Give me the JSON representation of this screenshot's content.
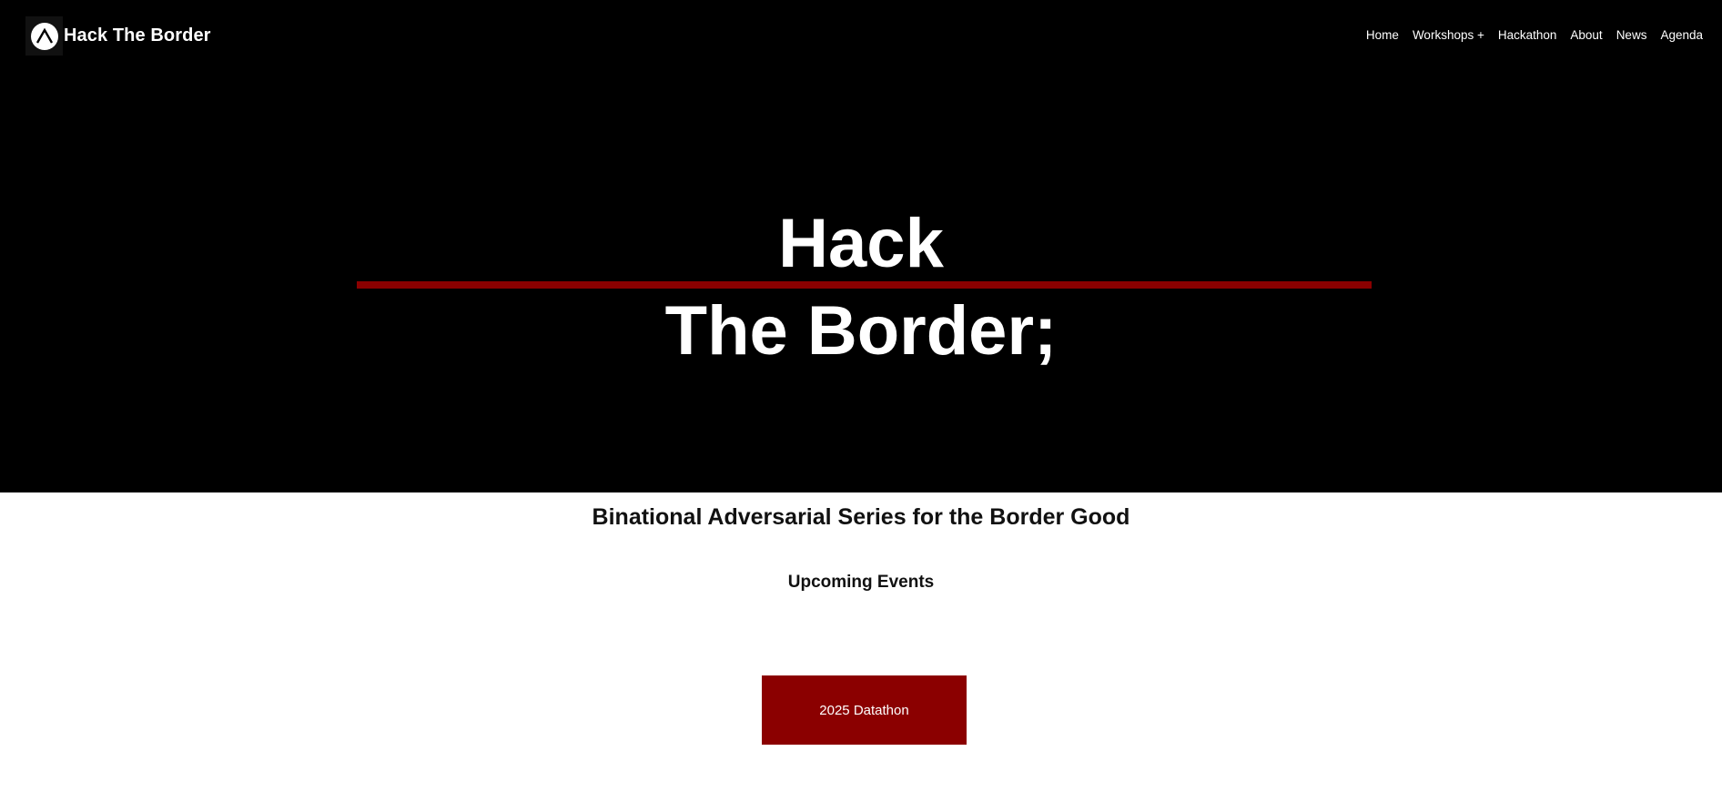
{
  "brand": {
    "name": "Hack The Border",
    "logo_icon": "peak-logo-icon"
  },
  "nav": {
    "items": [
      {
        "label": "Home"
      },
      {
        "label": "Workshops +"
      },
      {
        "label": "Hackathon"
      },
      {
        "label": "About"
      },
      {
        "label": "News"
      },
      {
        "label": "Agenda"
      }
    ]
  },
  "hero": {
    "title_line1": "Hack",
    "title_line2": "The Border;"
  },
  "main": {
    "tagline": "Binational Adversarial Series for the Border Good",
    "section_heading": "Upcoming Events",
    "events": [
      {
        "label": "2025 Datathon"
      }
    ]
  },
  "colors": {
    "accent": "#8b0000",
    "hero_background": "#000000",
    "page_background": "#ffffff",
    "hero_text": "#ffffff",
    "body_text": "#111111"
  }
}
